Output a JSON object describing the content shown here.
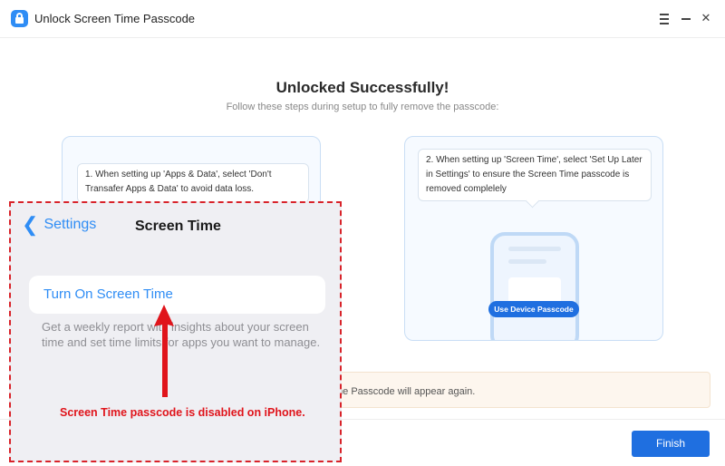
{
  "window": {
    "title": "Unlock Screen Time Passcode",
    "icon": "lock-app-icon",
    "controls": [
      "menu-icon",
      "minimize-icon",
      "close-icon"
    ],
    "close_glyph": "✕"
  },
  "main": {
    "headline": "Unlocked Successfully!",
    "subheadline": "Follow these steps during setup to fully remove the passcode:"
  },
  "steps": [
    {
      "text": "1. When setting up 'Apps & Data', select 'Don't Transafer Apps & Data' to avoid data loss."
    },
    {
      "text": "2. When setting up 'Screen Time', select 'Set Up Later in Settings' to ensure the Screen Time passcode is removed complelely",
      "button": "Use Device Passcode"
    }
  ],
  "warning": {
    "visible_text": "me Passcode will appear again."
  },
  "footer": {
    "finish_label": "Finish"
  },
  "overlay": {
    "back_label": "Settings",
    "title": "Screen Time",
    "row_label": "Turn On Screen Time",
    "description": "Get a weekly report with insights about your screen time and set time limits for apps you want to manage.",
    "caption": "Screen Time passcode is disabled on iPhone."
  },
  "colors": {
    "accent": "#1f6fe0",
    "ios_blue": "#2f8df5",
    "annotation_red": "#d8232a"
  }
}
